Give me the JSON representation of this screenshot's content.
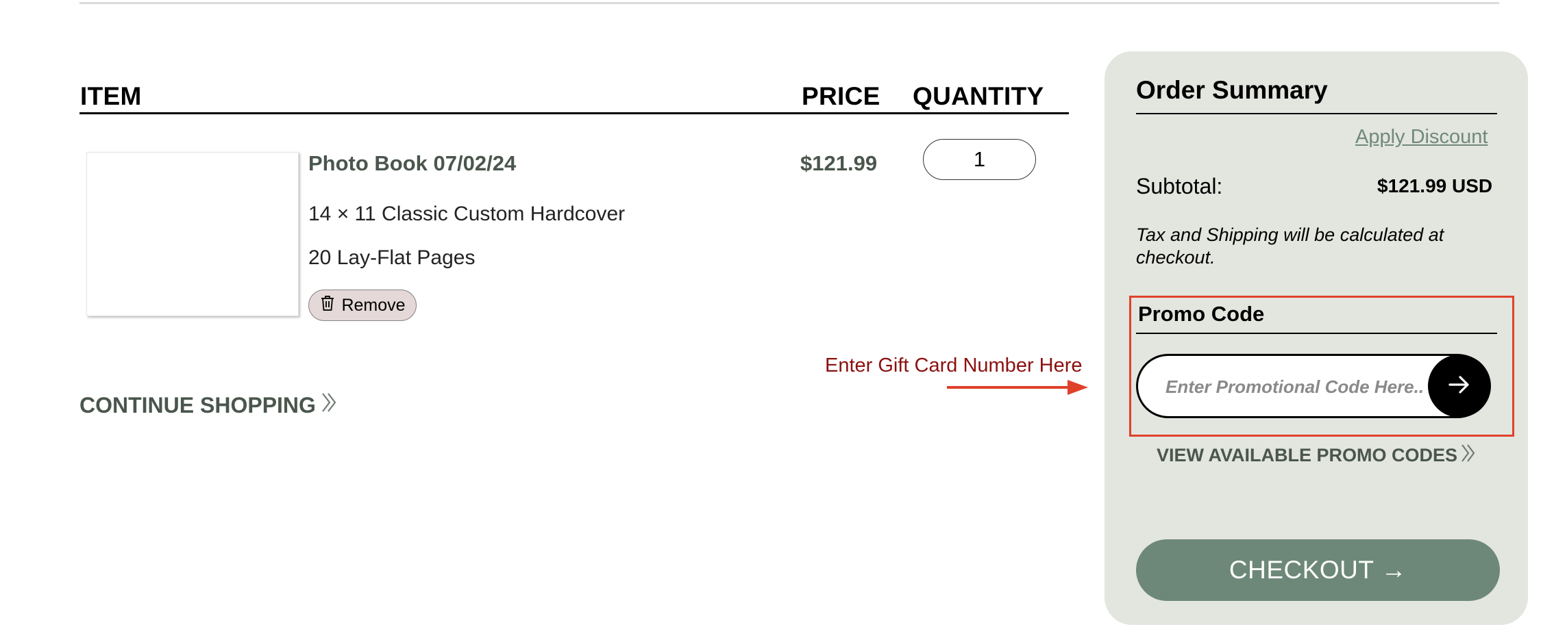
{
  "cart": {
    "headers": {
      "item": "ITEM",
      "price": "PRICE",
      "quantity": "QUANTITY"
    },
    "items": [
      {
        "title": "Photo Book 07/02/24",
        "size": "14 × 11 Classic Custom Hardcover",
        "pages": "20 Lay-Flat Pages",
        "price": "$121.99",
        "quantity": "1",
        "remove_label": "Remove"
      }
    ],
    "continue_label": "CONTINUE SHOPPING"
  },
  "annotation": {
    "text": "Enter Gift Card Number Here",
    "color": "#e0412b"
  },
  "summary": {
    "title": "Order Summary",
    "apply_discount": "Apply Discount",
    "subtotal_label": "Subtotal:",
    "subtotal_value": "$121.99 USD",
    "tax_note": "Tax and Shipping will be calculated at checkout.",
    "promo": {
      "title": "Promo Code",
      "placeholder": "Enter Promotional Code Here..",
      "view_label": "VIEW AVAILABLE PROMO CODES"
    },
    "checkout_label": "CHECKOUT →"
  },
  "colors": {
    "accent_green": "#6d8878",
    "panel_bg": "#e3e5df",
    "highlight": "#e0412b"
  }
}
